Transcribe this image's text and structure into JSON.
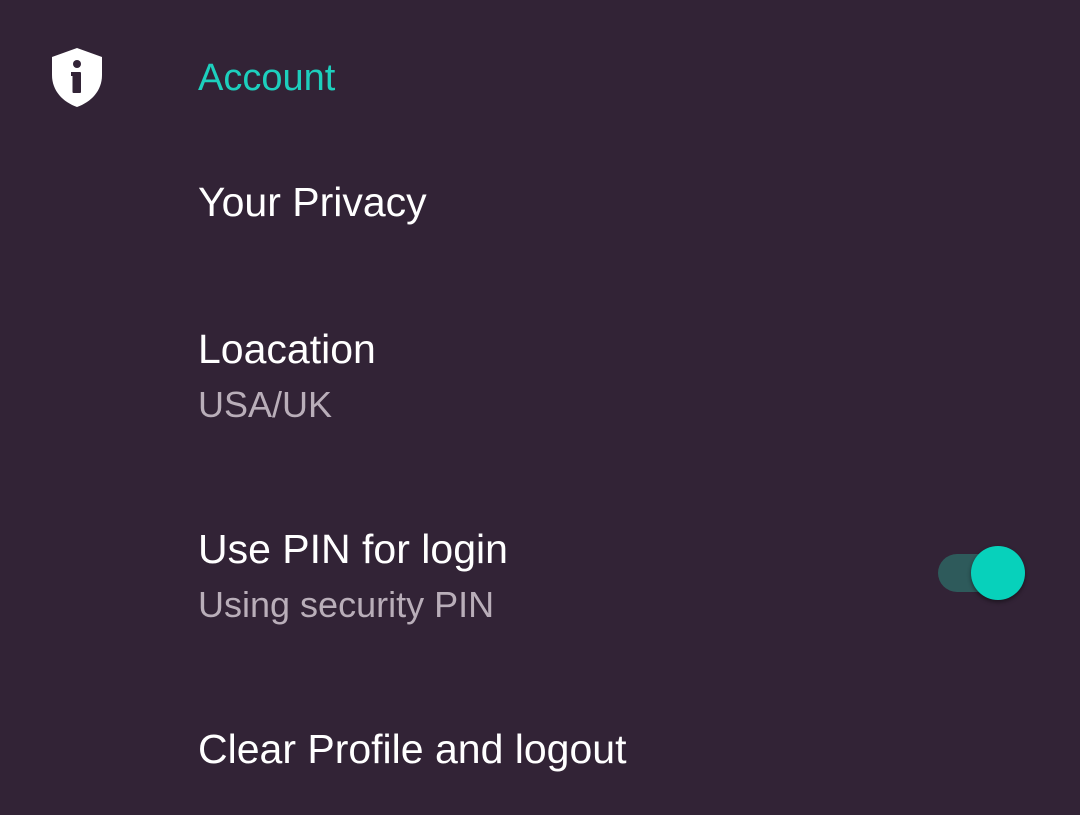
{
  "section": {
    "icon": "shield-info-icon",
    "title": "Account",
    "accent_color": "#1dcfbd"
  },
  "preferences": [
    {
      "title": "Your Privacy"
    },
    {
      "title": "Loacation",
      "summary": "USA/UK"
    },
    {
      "title": "Use PIN for login",
      "summary": "Using security PIN",
      "switch_on": true
    },
    {
      "title": "Clear Profile and logout"
    }
  ],
  "colors": {
    "background": "#322336",
    "title_text": "#ffffff",
    "summary_text": "#b9aeb9",
    "switch_thumb": "#07d1bb",
    "switch_track": "#2e5a5b"
  }
}
